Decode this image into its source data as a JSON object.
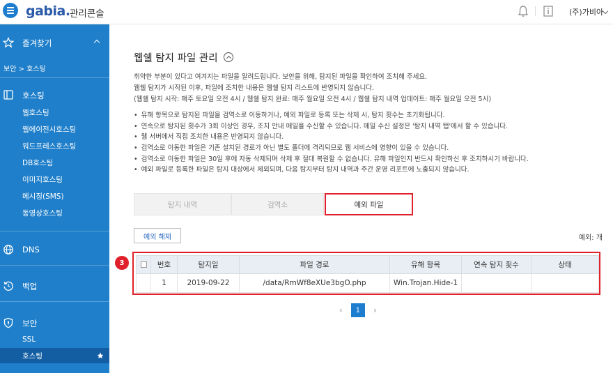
{
  "header": {
    "logo": "gabia.",
    "console": "관리콘솔",
    "user": "(주)가비아"
  },
  "sidebar": {
    "favorites": "즐겨찾기",
    "breadcrumb": "보안 > 호스팅",
    "hosting": {
      "label": "호스팅",
      "items": [
        "웹호스팅",
        "웹에이전시호스팅",
        "워드프레스호스팅",
        "DB호스팅",
        "이미지호스팅",
        "메시징(SMS)",
        "동영상호스팅"
      ]
    },
    "dns": "DNS",
    "backup": "백업",
    "security": {
      "label": "보안",
      "items": [
        "SSL",
        "호스팅"
      ]
    }
  },
  "main": {
    "title": "웹쉘 탐지 파일 관리",
    "desc": [
      "취약한 부분이 있다고 여겨지는 파일을 알려드립니다. 보안을 위해, 탐지된 파일을 확인하여 조치해 주세요.",
      "웹쉘 탐지가 시작된 이후, 파일에 조치한 내용은 웹쉘 탐지 리스트에 반영되지 않습니다.",
      "(웹쉘 탐지 시작: 매주 토요일 오전 4시 / 웹쉘 탐지 완료: 매주 월요일 오전 4시 / 웹쉘 탐지 내역 업데이트: 매주 월요일 오전 5시)"
    ],
    "bullets": [
      "유해 항목으로 탐지된 파일을 검역소로 이동하거나, 예외 파일로 등록 또는 삭제 시, 탐지 횟수는 초기화됩니다.",
      "연속으로 탐지된 횟수가 3회 이상인 경우, 조치 안내 메일을 수신할 수 있습니다. 메일 수신 설정은 '탐지 내역 탭'에서 할 수 있습니다.",
      "웹 서버에서 직접 조치한 내용은 반영되지 않습니다.",
      "검역소로 이동한 파일은 기존 설치된 경로가 아닌 별도 폴더에 격리되므로 웹 서비스에 영향이 있을 수 있습니다.",
      "검역소로 이동한 파일은 30일 후에 자동 삭제되며 삭제 후 절대 복원할 수 없습니다. 유해 파일인지 반드시 확인하신 후 조치하시기 바랍니다.",
      "예외 파일로 등록한 파일은 탐지 대상에서 제외되며, 다음 탐지부터 탐지 내역과 주간 운영 리포트에 노출되지 않습니다."
    ],
    "tabs": [
      "탐지 내역",
      "검역소",
      "예외 파일"
    ],
    "release_button": "예외 해제",
    "count_label": "예외:  개",
    "badge": "3",
    "table": {
      "headers": [
        "번호",
        "탐지일",
        "파일 경로",
        "유해 항목",
        "연속 탐지 횟수",
        "상태"
      ],
      "rows": [
        [
          "1",
          "2019-09-22",
          "/data/RmWf8eXUe3bgO.php",
          "Win.Trojan.Hide-1",
          "",
          ""
        ]
      ]
    },
    "pager": {
      "prev": "‹",
      "current": "1",
      "next": "›"
    }
  }
}
